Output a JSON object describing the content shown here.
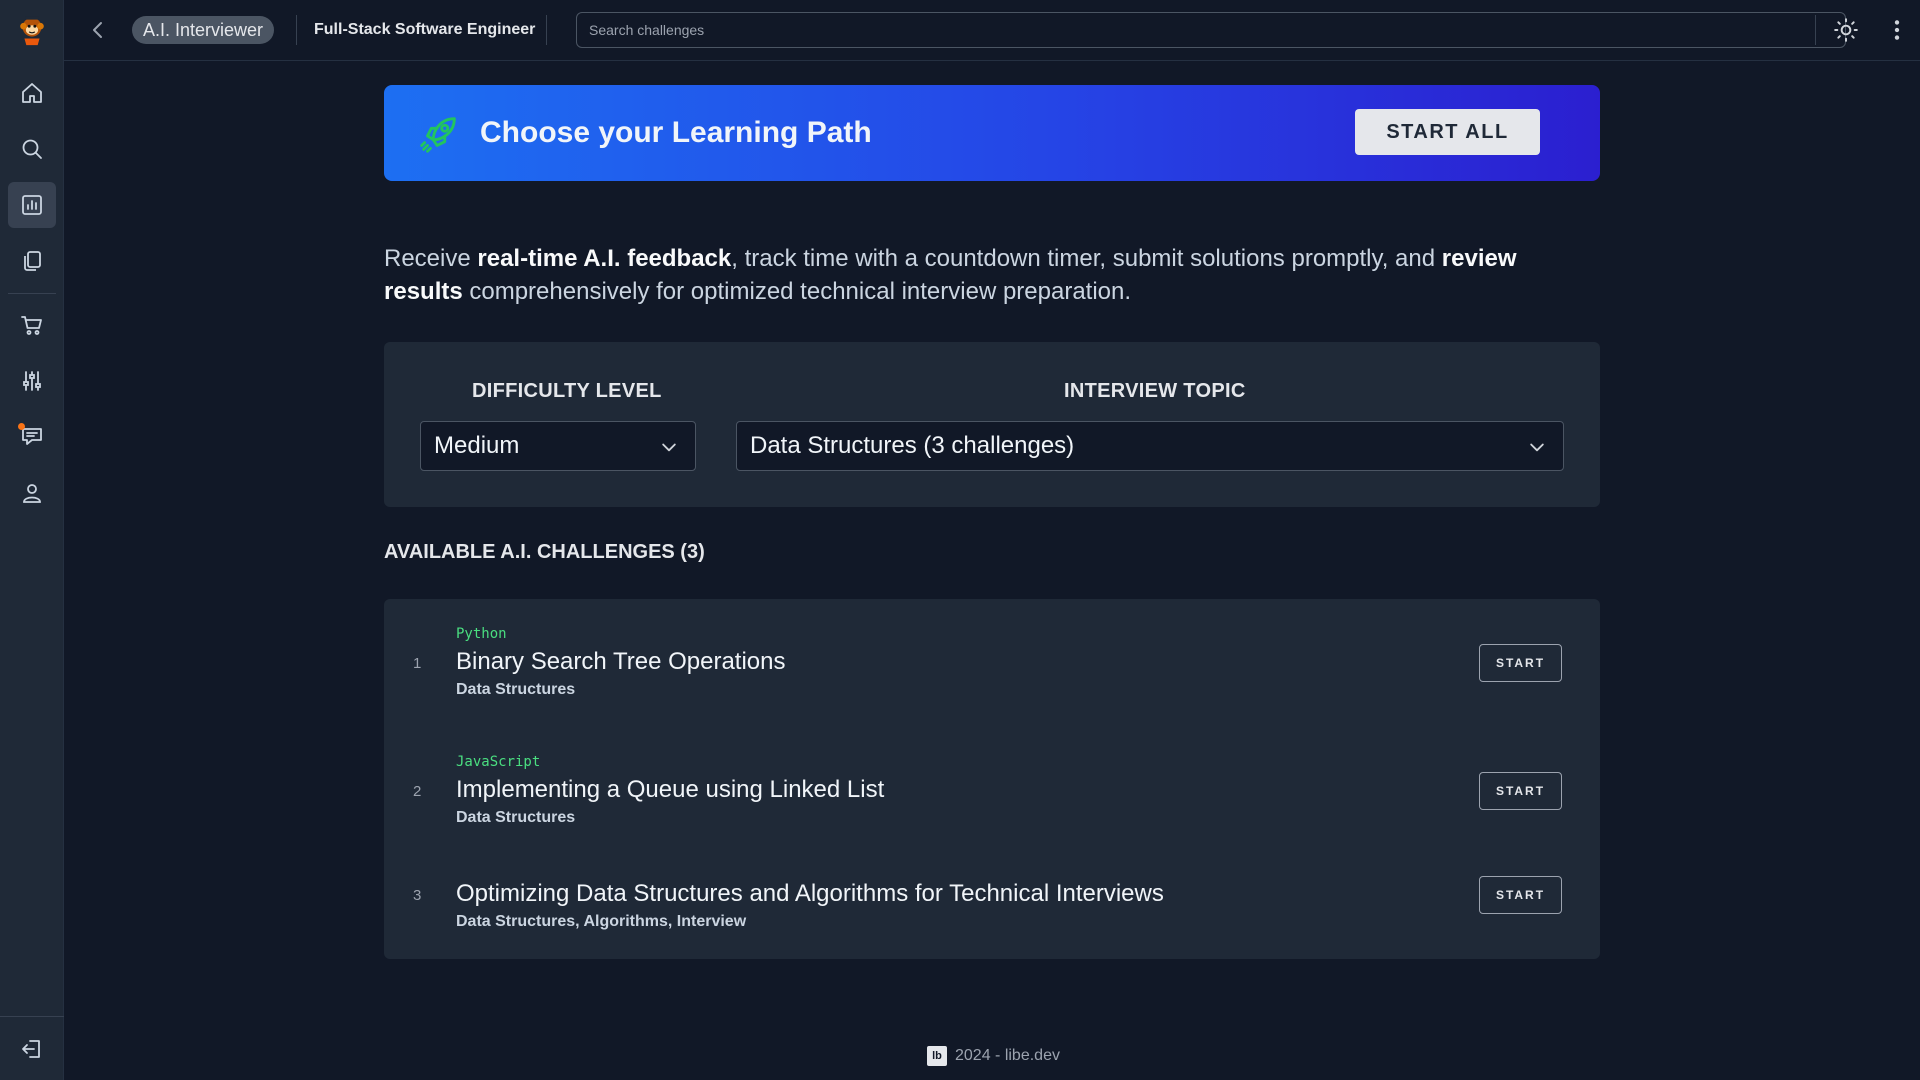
{
  "header": {
    "pill_label": "A.I. Interviewer",
    "breadcrumb": "Full-Stack Software Engineer",
    "search_placeholder": "Search challenges"
  },
  "sidebar": {
    "items": [
      {
        "icon": "home-icon"
      },
      {
        "icon": "search-icon"
      },
      {
        "icon": "chart-icon",
        "active": true
      },
      {
        "icon": "documents-icon"
      },
      {
        "icon": "cart-icon"
      },
      {
        "icon": "sliders-icon"
      },
      {
        "icon": "messages-icon"
      },
      {
        "icon": "user-icon"
      }
    ],
    "bottom_icon": "logout-icon"
  },
  "hero": {
    "title": "Choose your Learning Path",
    "button": "START ALL"
  },
  "intro": {
    "t1": "Receive ",
    "b1": "real-time A.I. feedback",
    "t2": ", track time with a countdown timer, submit solutions promptly, and ",
    "b2": "review results",
    "t3": " comprehensively for optimized technical interview preparation."
  },
  "filters": {
    "difficulty_label": "DIFFICULTY LEVEL",
    "difficulty_value": "Medium",
    "topic_label": "INTERVIEW TOPIC",
    "topic_value": "Data Structures (3 challenges)"
  },
  "challenges": {
    "heading": "AVAILABLE A.I. CHALLENGES (3)",
    "items": [
      {
        "num": "1",
        "lang": "Python",
        "title": "Binary Search Tree Operations",
        "tags": "Data Structures",
        "button": "START"
      },
      {
        "num": "2",
        "lang": "JavaScript",
        "title": "Implementing a Queue using Linked List",
        "tags": "Data Structures",
        "button": "START"
      },
      {
        "num": "3",
        "lang": "",
        "title": "Optimizing Data Structures and Algorithms for Technical Interviews",
        "tags": "Data Structures, Algorithms, Interview",
        "button": "START"
      }
    ]
  },
  "footer": {
    "logo_text": "lb",
    "text": "2024 - libe.dev"
  },
  "colors": {
    "accent_green": "#22c55e",
    "hero_gradient_start": "#1d6ff2",
    "hero_gradient_end": "#2b1fd0",
    "background": "#111827",
    "card": "#1f2937"
  }
}
